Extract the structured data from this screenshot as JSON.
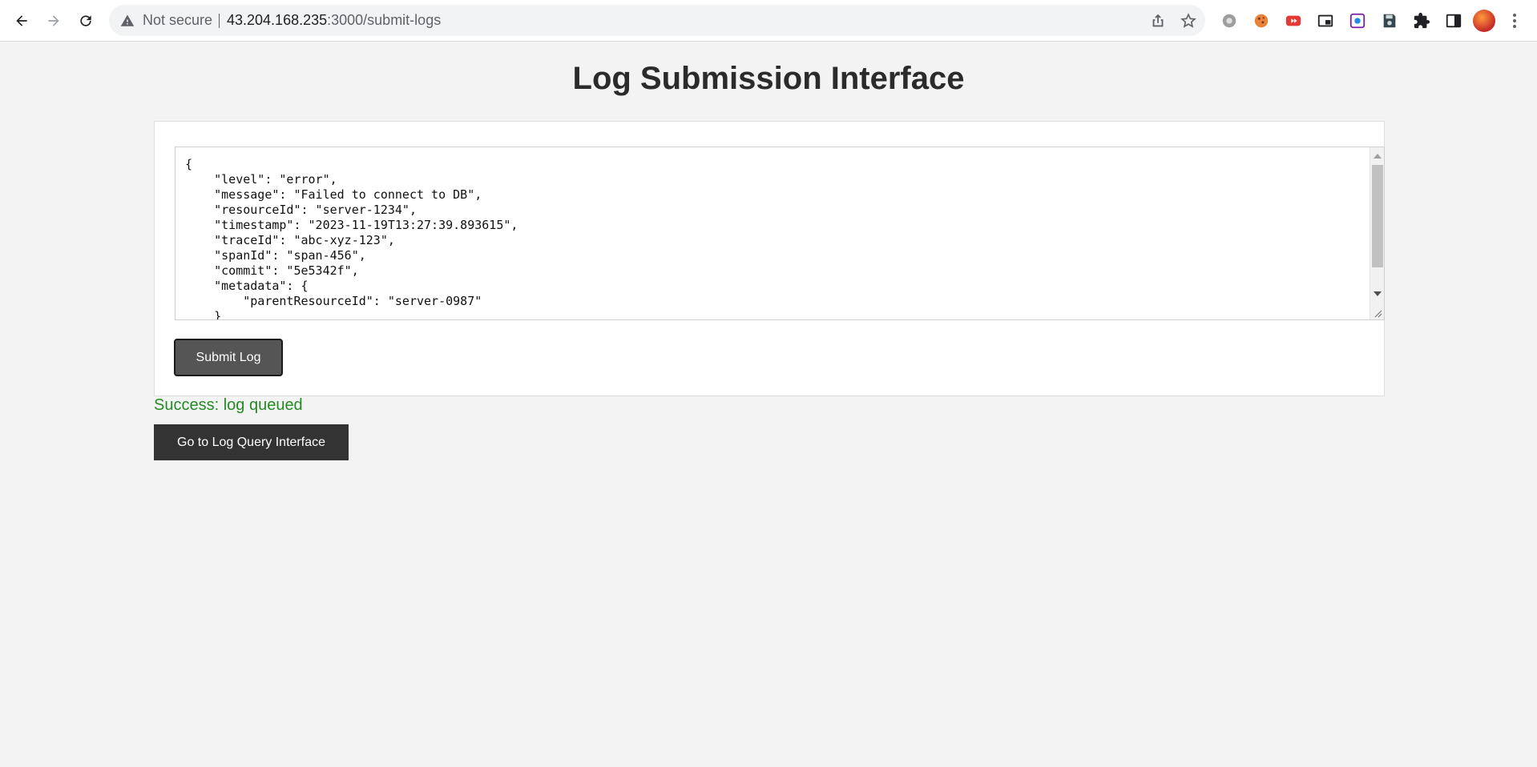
{
  "browser": {
    "security_label": "Not secure",
    "url_host": "43.204.168.235",
    "url_path": ":3000/submit-logs",
    "icons": [
      "back-icon",
      "forward-icon",
      "reload-icon",
      "warning-icon",
      "share-icon",
      "star-icon",
      "settings-extension-icon",
      "cookie-extension-icon",
      "video-extension-icon",
      "picture-in-picture-icon",
      "screen-capture-icon",
      "save-extension-icon",
      "puzzle-icon",
      "side-panel-icon",
      "profile-avatar",
      "menu-dots-icon"
    ]
  },
  "page": {
    "title": "Log Submission Interface",
    "log_lines": [
      "{",
      "    \"level\": \"error\",",
      "    \"message\": \"Failed to connect to DB\",",
      "    \"resourceId\": \"server-1234\",",
      "    \"timestamp\": \"2023-11-19T13:27:39.893615\",",
      "    \"traceId\": \"abc-xyz-123\",",
      "    \"spanId\": \"span-456\",",
      "    \"commit\": \"5e5342f\",",
      "    \"metadata\": {",
      "        \"parentResourceId\": \"server-0987\"",
      "    }"
    ],
    "submit_label": "Submit Log",
    "status_message": "Success: log queued",
    "query_button_label": "Go to Log Query Interface"
  },
  "colors": {
    "page_background": "#f3f3f3",
    "success_text": "#248a24",
    "submit_button": "#555555",
    "query_button": "#333333"
  }
}
